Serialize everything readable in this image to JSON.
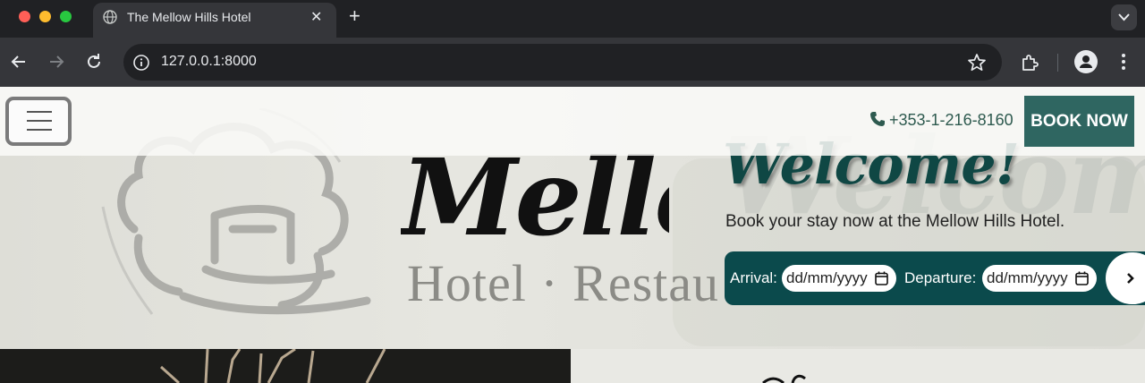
{
  "browser": {
    "tab_title": "The Mellow Hills Hotel",
    "url": "127.0.0.1:8000",
    "tab_close": "✕",
    "new_tab": "+"
  },
  "header": {
    "phone": "+353-1-216-8160",
    "book_button": "BOOK NOW"
  },
  "hero": {
    "brand_script": "Mellow",
    "brand_sub": "Hotel · Restau",
    "watermark": "Welcome Hills",
    "welcome": "Welcome!",
    "tagline": "Book your stay now at the Mellow Hills Hotel."
  },
  "booking": {
    "arrival_label": "Arrival:",
    "arrival_value": "dd/mm/yyyy",
    "departure_label": "Departure:",
    "departure_value": "dd/mm/yyyy"
  },
  "colors": {
    "accent": "#2f6661",
    "booking_bar": "#0b4a4c",
    "welcome": "#0f4744"
  }
}
